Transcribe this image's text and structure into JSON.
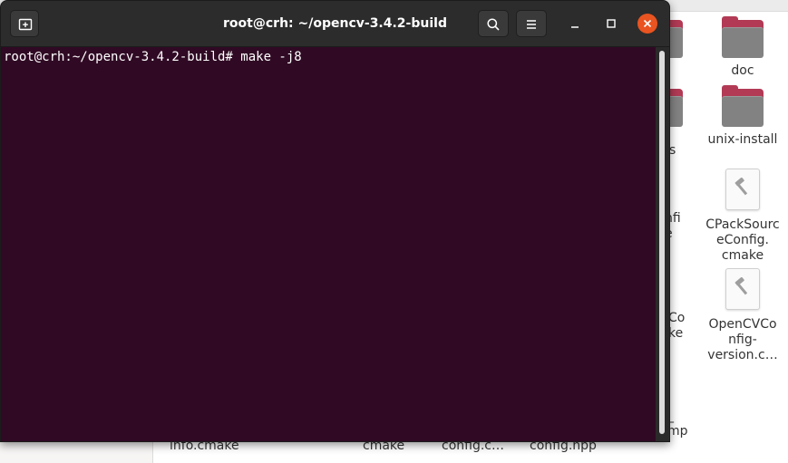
{
  "terminal": {
    "title": "root@crh: ~/opencv-3.4.2-build",
    "command_line": "root@crh:~/opencv-3.4.2-build# make -j8",
    "colors": {
      "background": "#300a24",
      "titlebar": "#2c2c2c",
      "close": "#e95420"
    },
    "icons": {
      "new_tab": "new-tab-icon",
      "search": "search-icon",
      "menu": "hamburger-menu-icon",
      "minimize": "minimize-icon",
      "maximize": "maximize-icon",
      "close": "close-icon"
    }
  },
  "file_manager": {
    "right_column": [
      {
        "name": "doc",
        "type": "folder"
      },
      {
        "name": "unix-install",
        "type": "folder"
      },
      {
        "name": "CPackSourc\neConfig.\ncmake",
        "type": "cmake-file"
      },
      {
        "name": "OpenCVCo\nnfig-\nversion.c…",
        "type": "cmake-file"
      }
    ],
    "peeking_labels": {
      "s": "s",
      "nfi_e": "nfi\ne",
      "co_ke": "Co\nke",
      "mp": "_\nmp"
    },
    "bottom_row": [
      {
        "name": "info.cmake"
      },
      {
        "name": "cmake"
      },
      {
        "name": "config.c…"
      },
      {
        "name": "config.hpp"
      }
    ]
  }
}
